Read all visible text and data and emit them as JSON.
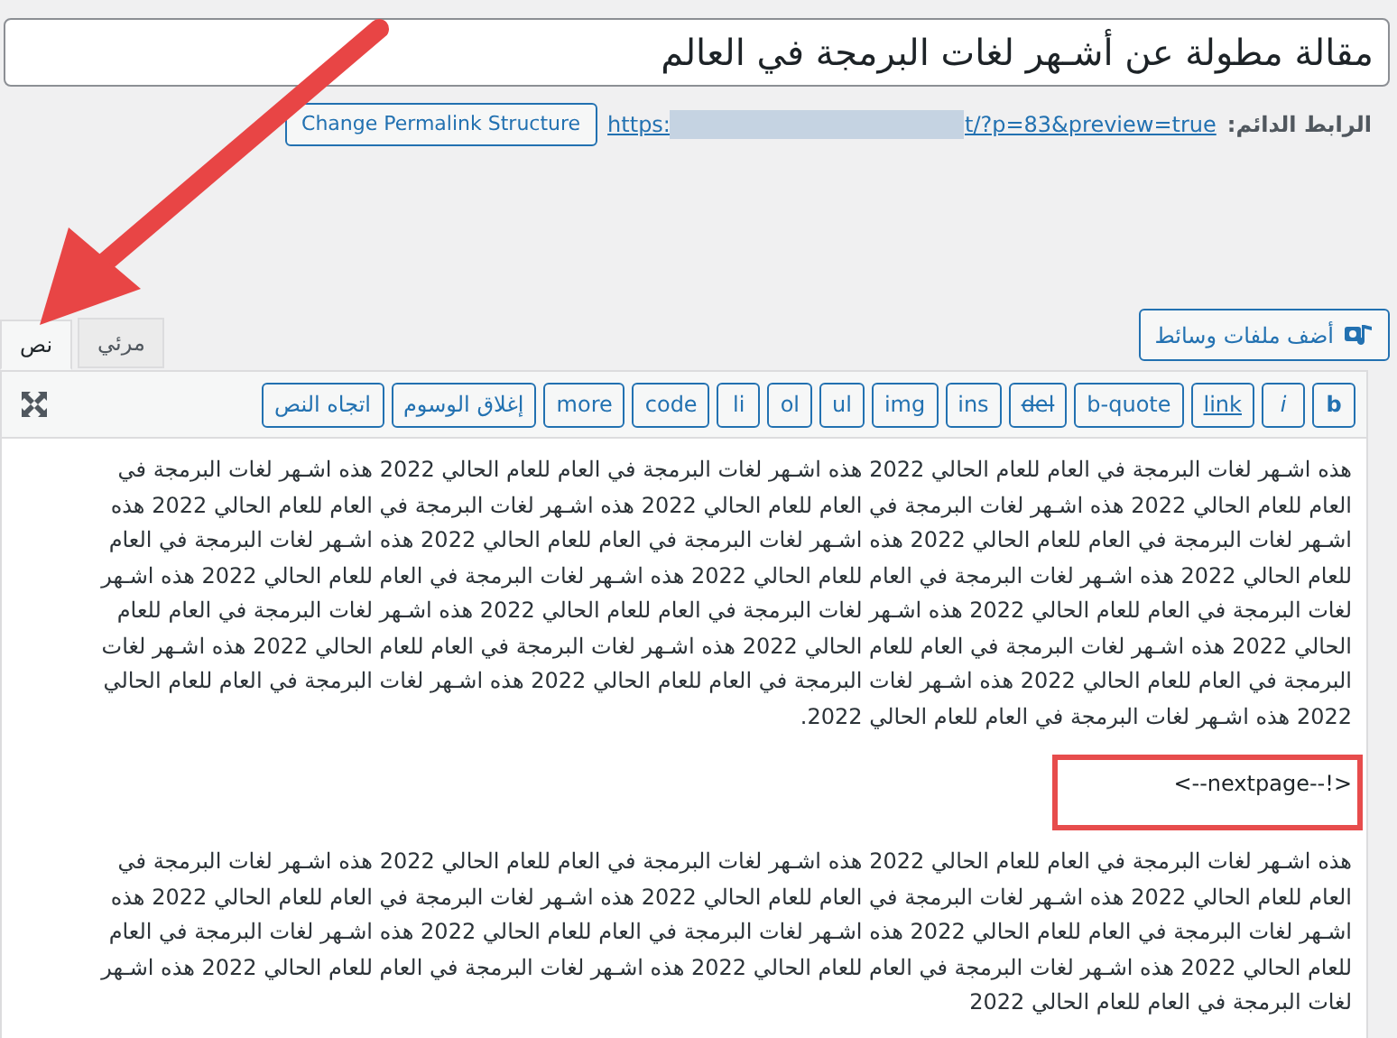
{
  "title_field": {
    "value": "مقالة مطولة عن أشـهر لغات البرمجة في العالم"
  },
  "permalink": {
    "label": "الرابط الدائم:",
    "url_start": "https:",
    "url_end": "t/?p=83&preview=true",
    "button": "Change Permalink Structure"
  },
  "media_button": "أضف ملفات وسائط",
  "tabs": [
    {
      "label": "مرئي",
      "selected": false
    },
    {
      "label": "نص",
      "selected": true
    }
  ],
  "toolbar": [
    {
      "label": "b",
      "kind": "bold"
    },
    {
      "label": "i",
      "kind": "italic"
    },
    {
      "label": "link",
      "kind": "link"
    },
    {
      "label": "b-quote",
      "kind": "plain"
    },
    {
      "label": "del",
      "kind": "strike"
    },
    {
      "label": "ins",
      "kind": "plain"
    },
    {
      "label": "img",
      "kind": "plain"
    },
    {
      "label": "ul",
      "kind": "plain"
    },
    {
      "label": "ol",
      "kind": "plain"
    },
    {
      "label": "li",
      "kind": "plain"
    },
    {
      "label": "code",
      "kind": "plain"
    },
    {
      "label": "more",
      "kind": "plain"
    },
    {
      "label": "إغلاق الوسوم",
      "kind": "plain"
    },
    {
      "label": "اتجاه النص",
      "kind": "plain"
    }
  ],
  "content": [
    {
      "kind": "paragraph",
      "lines": [
        "هذه اشـهر لغات البرمجة في العام للعام الحالي 2022 هذه اشـهر لغات البرمجة في العام للعام الحالي 2022 هذه اشـهر لغات البرمجة في",
        "العام للعام الحالي 2022 هذه اشـهر لغات البرمجة في العام للعام الحالي 2022 هذه اشـهر لغات البرمجة في العام للعام الحالي 2022 هذه",
        "اشـهر لغات البرمجة في العام للعام الحالي 2022 هذه اشـهر لغات البرمجة في العام للعام الحالي 2022 هذه اشـهر لغات البرمجة في العام",
        "للعام الحالي 2022 هذه اشـهر لغات البرمجة في العام للعام الحالي 2022 هذه اشـهر لغات البرمجة في العام للعام الحالي 2022 هذه اشـهر",
        "لغات البرمجة في العام للعام الحالي 2022 هذه اشـهر لغات البرمجة في العام للعام الحالي 2022 هذه اشـهر لغات البرمجة في العام للعام",
        "الحالي 2022 هذه اشـهر لغات البرمجة في العام للعام الحالي 2022 هذه اشـهر لغات البرمجة في العام للعام الحالي 2022 هذه اشـهر لغات",
        "البرمجة في العام للعام الحالي 2022 هذه اشـهر لغات البرمجة في العام للعام الحالي 2022 هذه اشـهر لغات البرمجة في العام للعام الحالي",
        "2022 هذه اشـهر لغات البرمجة في العام للعام الحالي 2022."
      ]
    },
    {
      "kind": "nextpage",
      "text": "<!--nextpage-->"
    },
    {
      "kind": "paragraph",
      "lines": [
        "هذه اشـهر لغات البرمجة في العام للعام الحالي 2022 هذه اشـهر لغات البرمجة في العام للعام الحالي 2022 هذه اشـهر لغات البرمجة في",
        "العام للعام الحالي 2022 هذه اشـهر لغات البرمجة في العام للعام الحالي 2022 هذه اشـهر لغات البرمجة في العام للعام الحالي 2022 هذه",
        "اشـهر لغات البرمجة في العام للعام الحالي 2022 هذه اشـهر لغات البرمجة في العام للعام الحالي 2022 هذه اشـهر لغات البرمجة في العام",
        "للعام الحالي 2022 هذه اشـهر لغات البرمجة في العام للعام الحالي 2022 هذه اشـهر لغات البرمجة في العام للعام الحالي 2022 هذه اشـهر",
        "لغات البرمجة في العام للعام الحالي 2022"
      ]
    }
  ]
}
